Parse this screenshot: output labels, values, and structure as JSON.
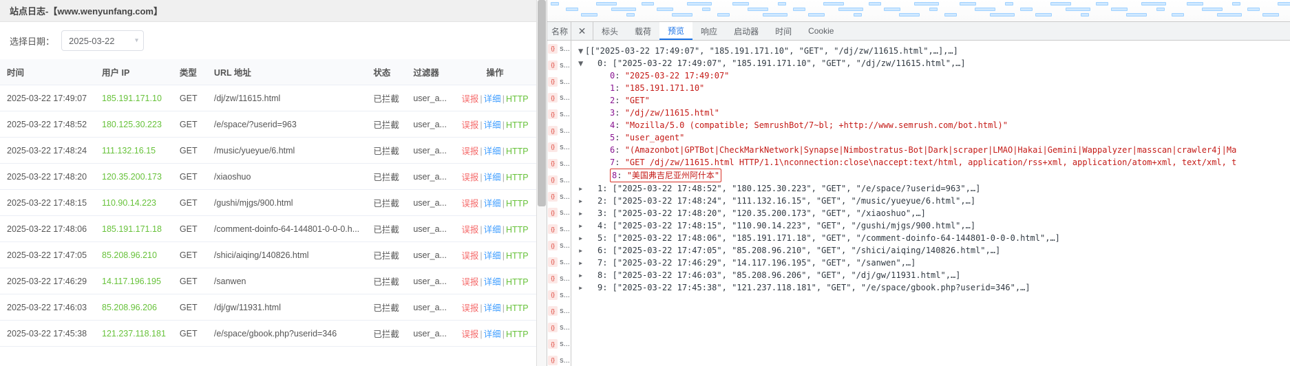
{
  "left": {
    "title": "站点日志-【www.wenyunfang.com】",
    "date_label": "选择日期：",
    "date_value": "2025-03-22",
    "columns": {
      "time": "时间",
      "ip": "用户 IP",
      "type": "类型",
      "url": "URL 地址",
      "status": "状态",
      "filter": "过滤器",
      "action": "操作"
    },
    "action_labels": {
      "report": "误报",
      "detail": "详细",
      "http": "HTTP"
    },
    "rows": [
      {
        "time": "2025-03-22 17:49:07",
        "ip": "185.191.171.10",
        "type": "GET",
        "url": "/dj/zw/11615.html",
        "status": "已拦截",
        "filter": "user_a..."
      },
      {
        "time": "2025-03-22 17:48:52",
        "ip": "180.125.30.223",
        "type": "GET",
        "url": "/e/space/?userid=963",
        "status": "已拦截",
        "filter": "user_a..."
      },
      {
        "time": "2025-03-22 17:48:24",
        "ip": "111.132.16.15",
        "type": "GET",
        "url": "/music/yueyue/6.html",
        "status": "已拦截",
        "filter": "user_a..."
      },
      {
        "time": "2025-03-22 17:48:20",
        "ip": "120.35.200.173",
        "type": "GET",
        "url": "/xiaoshuo",
        "status": "已拦截",
        "filter": "user_a..."
      },
      {
        "time": "2025-03-22 17:48:15",
        "ip": "110.90.14.223",
        "type": "GET",
        "url": "/gushi/mjgs/900.html",
        "status": "已拦截",
        "filter": "user_a..."
      },
      {
        "time": "2025-03-22 17:48:06",
        "ip": "185.191.171.18",
        "type": "GET",
        "url": "/comment-doinfo-64-144801-0-0-0.h...",
        "status": "已拦截",
        "filter": "user_a..."
      },
      {
        "time": "2025-03-22 17:47:05",
        "ip": "85.208.96.210",
        "type": "GET",
        "url": "/shici/aiqing/140826.html",
        "status": "已拦截",
        "filter": "user_a..."
      },
      {
        "time": "2025-03-22 17:46:29",
        "ip": "14.117.196.195",
        "type": "GET",
        "url": "/sanwen",
        "status": "已拦截",
        "filter": "user_a..."
      },
      {
        "time": "2025-03-22 17:46:03",
        "ip": "85.208.96.206",
        "type": "GET",
        "url": "/dj/gw/11931.html",
        "status": "已拦截",
        "filter": "user_a..."
      },
      {
        "time": "2025-03-22 17:45:38",
        "ip": "121.237.118.181",
        "type": "GET",
        "url": "/e/space/gbook.php?userid=346",
        "status": "已拦截",
        "filter": "user_a..."
      }
    ]
  },
  "dev": {
    "name_header": "名称",
    "close": "✕",
    "tabs": [
      "标头",
      "载荷",
      "预览",
      "响应",
      "启动器",
      "时间",
      "Cookie"
    ],
    "active_tab": 2,
    "name_items_count": 20,
    "name_item_label": "s...",
    "top": "[[\"2025-03-22 17:49:07\", \"185.191.171.10\", \"GET\", \"/dj/zw/11615.html\",…],…]",
    "expanded": {
      "header": "0: [\"2025-03-22 17:49:07\", \"185.191.171.10\", \"GET\", \"/dj/zw/11615.html\",…]",
      "items": [
        {
          "k": "0",
          "v": "\"2025-03-22 17:49:07\""
        },
        {
          "k": "1",
          "v": "\"185.191.171.10\""
        },
        {
          "k": "2",
          "v": "\"GET\""
        },
        {
          "k": "3",
          "v": "\"/dj/zw/11615.html\""
        },
        {
          "k": "4",
          "v": "\"Mozilla/5.0 (compatible; SemrushBot/7~bl; +http://www.semrush.com/bot.html)\""
        },
        {
          "k": "5",
          "v": "\"user_agent\""
        },
        {
          "k": "6",
          "v": "\"(Amazonbot|GPTBot|CheckMarkNetwork|Synapse|Nimbostratus-Bot|Dark|scraper|LMAO|Hakai|Gemini|Wappalyzer|masscan|crawler4j|Ma"
        },
        {
          "k": "7",
          "v": "\"GET /dj/zw/11615.html HTTP/1.1\\nconnection:close\\naccept:text/html, application/rss+xml, application/atom+xml, text/xml, t"
        },
        {
          "k": "8",
          "v": "\"美国弗吉尼亚州阿什本\""
        }
      ],
      "highlight_index": 8
    },
    "rest": [
      "1: [\"2025-03-22 17:48:52\", \"180.125.30.223\", \"GET\", \"/e/space/?userid=963\",…]",
      "2: [\"2025-03-22 17:48:24\", \"111.132.16.15\", \"GET\", \"/music/yueyue/6.html\",…]",
      "3: [\"2025-03-22 17:48:20\", \"120.35.200.173\", \"GET\", \"/xiaoshuo\",…]",
      "4: [\"2025-03-22 17:48:15\", \"110.90.14.223\", \"GET\", \"/gushi/mjgs/900.html\",…]",
      "5: [\"2025-03-22 17:48:06\", \"185.191.171.18\", \"GET\", \"/comment-doinfo-64-144801-0-0-0.html\",…]",
      "6: [\"2025-03-22 17:47:05\", \"85.208.96.210\", \"GET\", \"/shici/aiqing/140826.html\",…]",
      "7: [\"2025-03-22 17:46:29\", \"14.117.196.195\", \"GET\", \"/sanwen\",…]",
      "8: [\"2025-03-22 17:46:03\", \"85.208.96.206\", \"GET\", \"/dj/gw/11931.html\",…]",
      "9: [\"2025-03-22 17:45:38\", \"121.237.118.181\", \"GET\", \"/e/space/gbook.php?userid=346\",…]"
    ]
  }
}
